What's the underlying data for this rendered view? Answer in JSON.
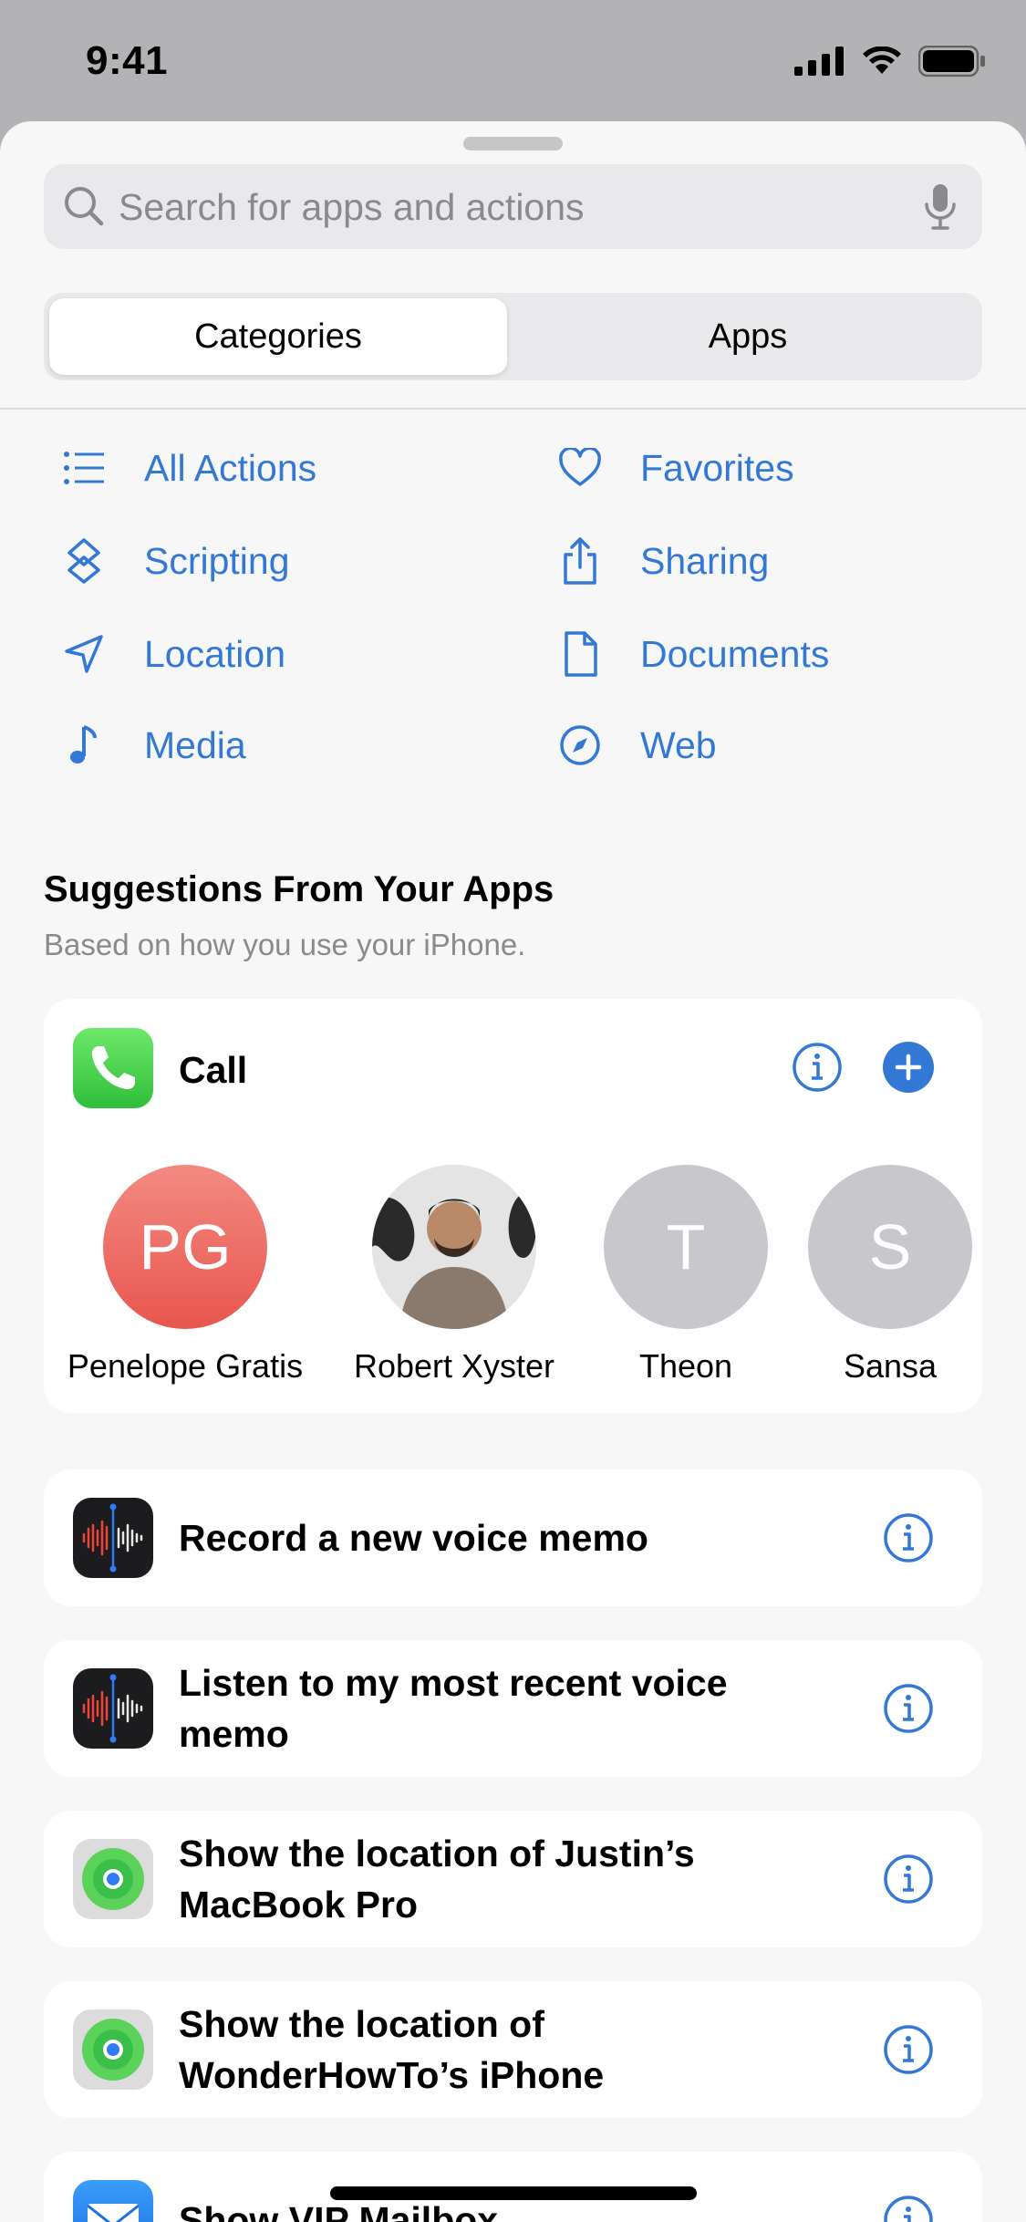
{
  "status": {
    "time": "9:41"
  },
  "search": {
    "placeholder": "Search for apps and actions"
  },
  "segments": {
    "categories": "Categories",
    "apps": "Apps"
  },
  "categories": [
    {
      "label": "All Actions",
      "icon": "list-icon"
    },
    {
      "label": "Favorites",
      "icon": "heart-icon"
    },
    {
      "label": "Scripting",
      "icon": "scripting-icon"
    },
    {
      "label": "Sharing",
      "icon": "share-icon"
    },
    {
      "label": "Location",
      "icon": "location-arrow-icon"
    },
    {
      "label": "Documents",
      "icon": "document-icon"
    },
    {
      "label": "Media",
      "icon": "music-note-icon"
    },
    {
      "label": "Web",
      "icon": "compass-icon"
    }
  ],
  "suggestions": {
    "title": "Suggestions From Your Apps",
    "subtitle": "Based on how you use your iPhone."
  },
  "call_card": {
    "label": "Call",
    "contacts": [
      {
        "initials": "PG",
        "name": "Penelope Gratis"
      },
      {
        "initials": "",
        "name": "Robert Xyster"
      },
      {
        "initials": "T",
        "name": "Theon"
      },
      {
        "initials": "S",
        "name": "Sansa"
      }
    ]
  },
  "actions": [
    {
      "label": "Record a new voice memo",
      "app": "voice-memos"
    },
    {
      "label": "Listen to my most recent voice memo",
      "app": "voice-memos"
    },
    {
      "label": "Show the location of Justin’s MacBook Pro",
      "app": "find-my"
    },
    {
      "label": "Show the location of WonderHowTo’s iPhone",
      "app": "find-my"
    },
    {
      "label": "Show VIP Mailbox",
      "app": "mail"
    }
  ],
  "colors": {
    "accent": "#3478d6",
    "pg_avatar": "#ee5f5a",
    "gray_avatar": "#c7c7cc"
  }
}
